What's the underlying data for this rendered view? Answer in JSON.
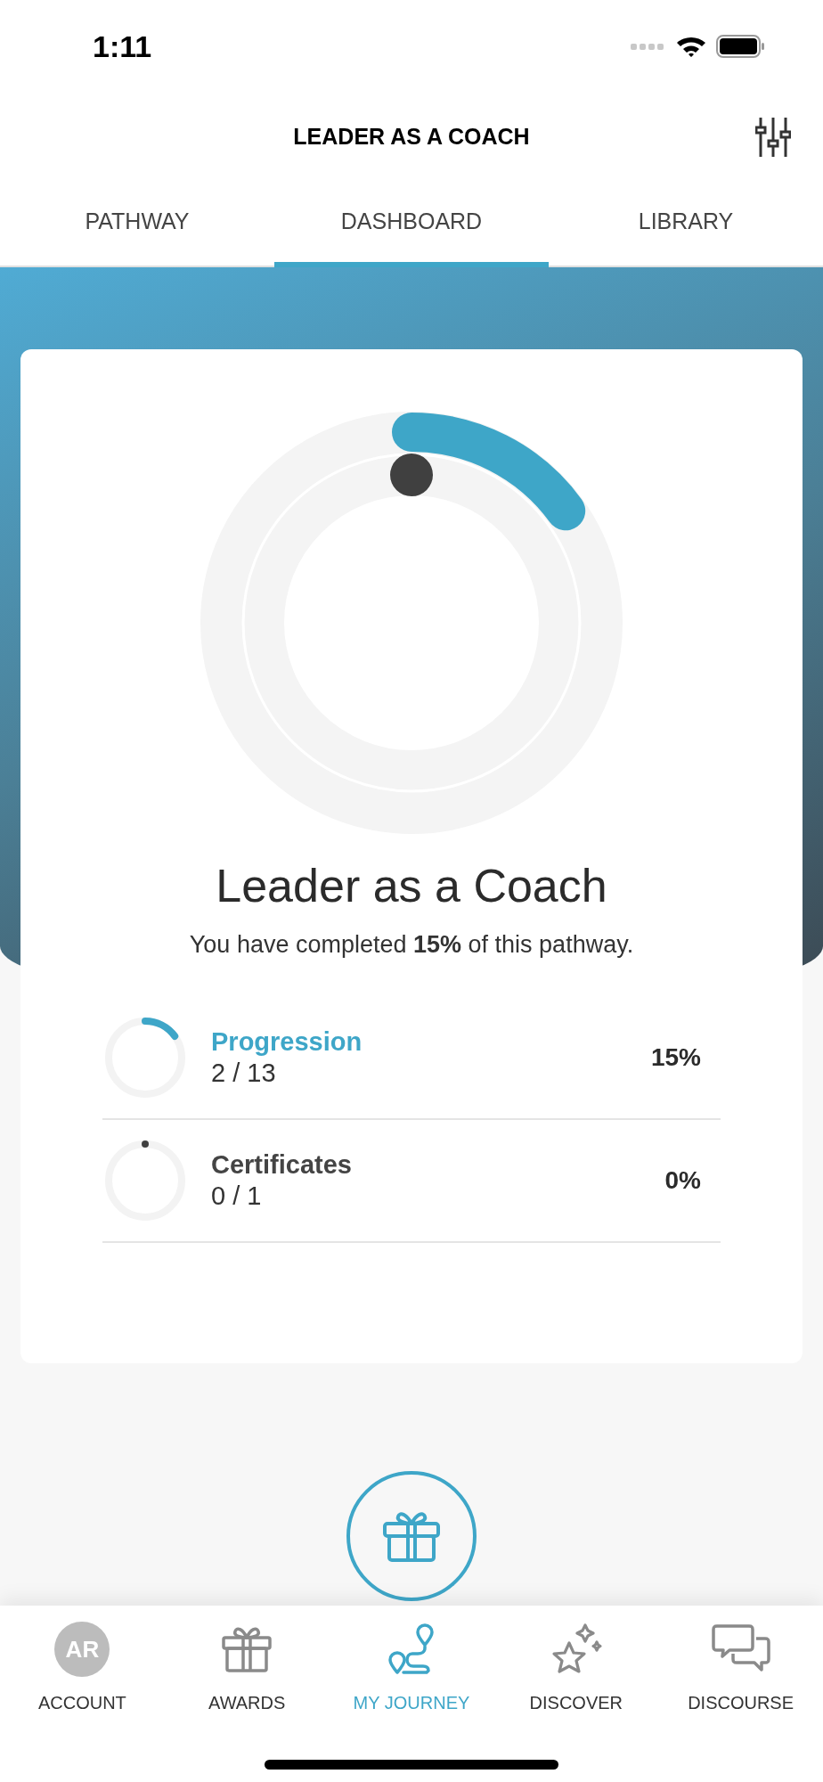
{
  "status_bar": {
    "time": "1:11"
  },
  "header": {
    "title": "LEADER AS A COACH"
  },
  "tabs": [
    {
      "label": "PATHWAY",
      "selected": false
    },
    {
      "label": "DASHBOARD",
      "selected": true
    },
    {
      "label": "LIBRARY",
      "selected": false
    }
  ],
  "pathway": {
    "title": "Leader as a Coach",
    "summary": "You have completed **15%** of this pathway.",
    "progress_ring": {
      "level": 0.15
    },
    "certificate_ring": {
      "level": 0
    }
  },
  "stats": [
    {
      "label": "Progression",
      "count": "2 / 13",
      "percent": "15%",
      "level": 0.15,
      "highlighted": true
    },
    {
      "label": "Certificates",
      "count": "0 / 1",
      "percent": "0%",
      "level": 0,
      "highlighted": false
    }
  ],
  "nav": [
    {
      "kind": "avatar",
      "initials": "AR",
      "label": "ACCOUNT",
      "selected": false
    },
    {
      "kind": "gift",
      "label": "AWARDS",
      "selected": false
    },
    {
      "kind": "route",
      "label": "MY JOURNEY",
      "selected": true
    },
    {
      "kind": "star",
      "label": "DISCOVER",
      "selected": false
    },
    {
      "kind": "chat",
      "label": "DISCOURSE",
      "selected": false
    }
  ]
}
